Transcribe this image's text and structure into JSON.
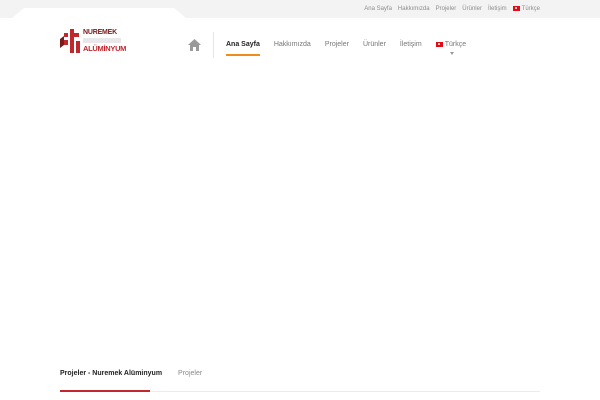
{
  "topbar": {
    "links": [
      "Ana Sayfa",
      "Hakkımızda",
      "Projeler",
      "Ürünler",
      "İletişim"
    ],
    "language": "Türkçe"
  },
  "logo": {
    "line1": "NUREMEK",
    "band": "",
    "line2": "ALÜMİNYUM"
  },
  "nav": {
    "items": [
      "Ana Sayfa",
      "Hakkımızda",
      "Projeler",
      "Ürünler",
      "İletişim"
    ],
    "active_index": 0,
    "language": "Türkçe"
  },
  "tabs": {
    "items": [
      "Projeler - Nuremek Alüminyum",
      "Projeler"
    ],
    "active_index": 0
  },
  "colors": {
    "accent_orange": "#f08b1d",
    "accent_red": "#c0282d",
    "topbar_bg": "#f3f3f3"
  }
}
